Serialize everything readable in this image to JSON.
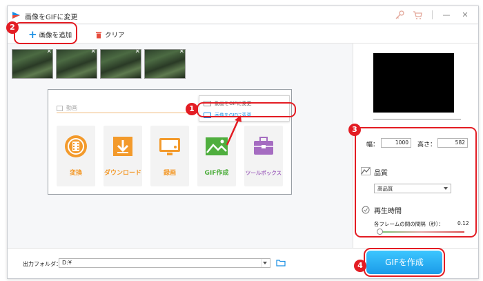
{
  "window": {
    "title": "画像をGIFに変更",
    "controls": {
      "minimize": "—",
      "close": "✕"
    }
  },
  "toolbar": {
    "add_label": "画像を追加",
    "clear_label": "クリア"
  },
  "badges": [
    "1",
    "2",
    "3",
    "4"
  ],
  "inner": {
    "section_label": "動画",
    "menu": [
      "動画をGIFに変更",
      "画像をGIFに変更"
    ],
    "tiles": [
      {
        "label": "変換",
        "color": "#f39a2b"
      },
      {
        "label": "ダウンロード",
        "color": "#f39a2b"
      },
      {
        "label": "録画",
        "color": "#f39a2b"
      },
      {
        "label": "GIF作成",
        "color": "#4fae3e"
      },
      {
        "label": "ツールボックス",
        "color": "#a56cc1"
      }
    ]
  },
  "settings": {
    "width_label": "幅：",
    "width_value": "1000",
    "height_label": "高さ：",
    "height_value": "582",
    "quality_label": "品質",
    "quality_value": "高品質",
    "playback_label": "再生時間",
    "interval_label": "各フレームの間の間隔（秒）：",
    "interval_value": "0.12"
  },
  "bottom": {
    "output_label": "出力フォルダ：",
    "output_value": "D:¥",
    "create_label": "GIFを作成"
  },
  "colors": {
    "accent": "#1a8fe3",
    "callout": "#e31c23",
    "button": "#1b9be8"
  }
}
